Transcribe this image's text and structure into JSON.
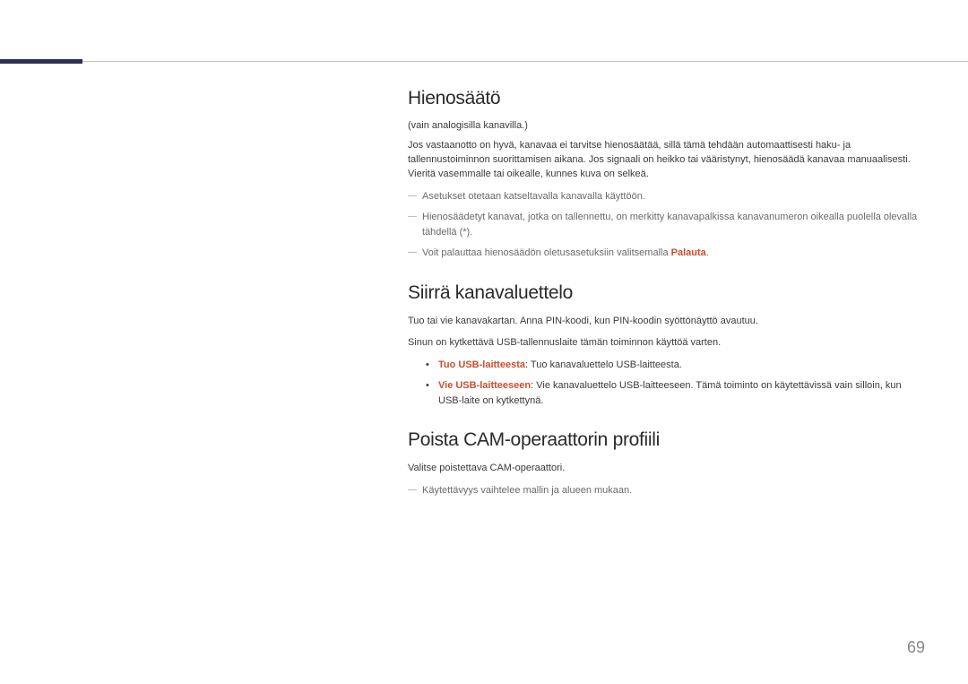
{
  "pageNumber": "69",
  "section1": {
    "title": "Hienosäätö",
    "subnote": "(vain analogisilla kanavilla.)",
    "body": "Jos vastaanotto on hyvä, kanavaa ei tarvitse hienosäätää, sillä tämä tehdään automaattisesti haku- ja tallennustoiminnon suorittamisen aikana. Jos signaali on heikko tai vääristynyt, hienosäädä kanavaa manuaalisesti. Vieritä vasemmalle tai oikealle, kunnes kuva on selkeä.",
    "notes": {
      "n1": "Asetukset otetaan katseltavalla kanavalla käyttöön.",
      "n2": "Hienosäädetyt kanavat, jotka on tallennettu, on merkitty kanavapalkissa kanavanumeron oikealla puolella olevalla tähdellä (*).",
      "n3_pre": "Voit palauttaa hienosäädön oletusasetuksiin valitsemalla ",
      "n3_hl": "Palauta",
      "n3_post": "."
    }
  },
  "section2": {
    "title": "Siirrä kanavaluettelo",
    "body1": "Tuo tai vie kanavakartan. Anna PIN-koodi, kun PIN-koodin syöttönäyttö avautuu.",
    "body2": "Sinun on kytkettävä USB-tallennuslaite tämän toiminnon käyttöä varten.",
    "items": {
      "i1_hl": "Tuo USB-laitteesta",
      "i1_rest": ": Tuo kanavaluettelo USB-laitteesta.",
      "i2_hl": "Vie USB-laitteeseen",
      "i2_rest": ": Vie kanavaluettelo USB-laitteeseen. Tämä toiminto on käytettävissä vain silloin, kun USB-laite on kytkettynä."
    }
  },
  "section3": {
    "title": "Poista CAM-operaattorin profiili",
    "body": "Valitse poistettava CAM-operaattori.",
    "notes": {
      "n1": "Käytettävyys vaihtelee mallin ja alueen mukaan."
    }
  }
}
